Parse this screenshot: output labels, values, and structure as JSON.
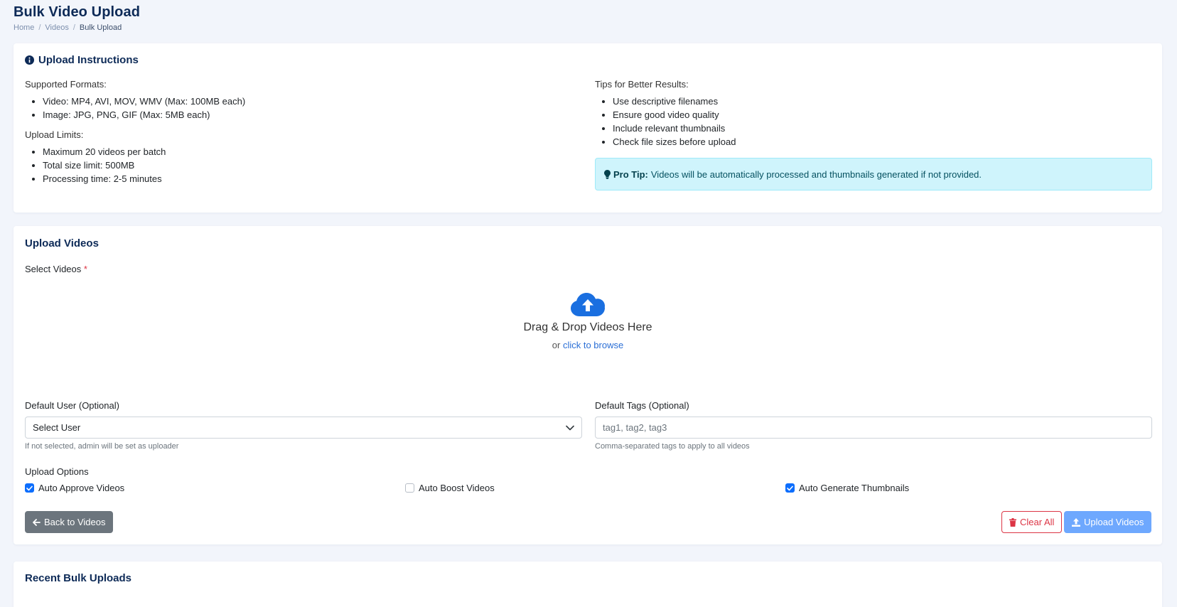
{
  "page": {
    "title": "Bulk Video Upload",
    "breadcrumb": [
      "Home",
      "Videos",
      "Bulk Upload"
    ]
  },
  "instructions": {
    "title": "Upload Instructions",
    "formats_label": "Supported Formats:",
    "formats": [
      "Video: MP4, AVI, MOV, WMV (Max: 100MB each)",
      "Image: JPG, PNG, GIF (Max: 5MB each)"
    ],
    "limits_label": "Upload Limits:",
    "limits": [
      "Maximum 20 videos per batch",
      "Total size limit: 500MB",
      "Processing time: 2-5 minutes"
    ],
    "tips_label": "Tips for Better Results:",
    "tips": [
      "Use descriptive filenames",
      "Ensure good video quality",
      "Include relevant thumbnails",
      "Check file sizes before upload"
    ],
    "pro_tip_label": "Pro Tip:",
    "pro_tip_text": "Videos will be automatically processed and thumbnails generated if not provided."
  },
  "upload": {
    "title": "Upload Videos",
    "select_label": "Select Videos",
    "required_mark": "*",
    "dropzone_title": "Drag & Drop Videos Here",
    "dropzone_or": "or",
    "dropzone_browse": "click to browse",
    "default_user_label": "Default User (Optional)",
    "default_user_value": "Select User",
    "default_user_help": "If not selected, admin will be set as uploader",
    "default_tags_label": "Default Tags (Optional)",
    "default_tags_placeholder": "tag1, tag2, tag3",
    "default_tags_help": "Comma-separated tags to apply to all videos",
    "options_label": "Upload Options",
    "options": [
      {
        "label": "Auto Approve Videos",
        "checked": true
      },
      {
        "label": "Auto Boost Videos",
        "checked": false
      },
      {
        "label": "Auto Generate Thumbnails",
        "checked": true
      }
    ],
    "back_label": "Back to Videos",
    "clear_label": "Clear All",
    "submit_label": "Upload Videos"
  },
  "recent": {
    "title": "Recent Bulk Uploads"
  },
  "colors": {
    "primary": "#0d6efd",
    "heading": "#0d2a57",
    "danger": "#dc3545",
    "secondary": "#6c757d",
    "info_bg": "#cff4fc"
  }
}
